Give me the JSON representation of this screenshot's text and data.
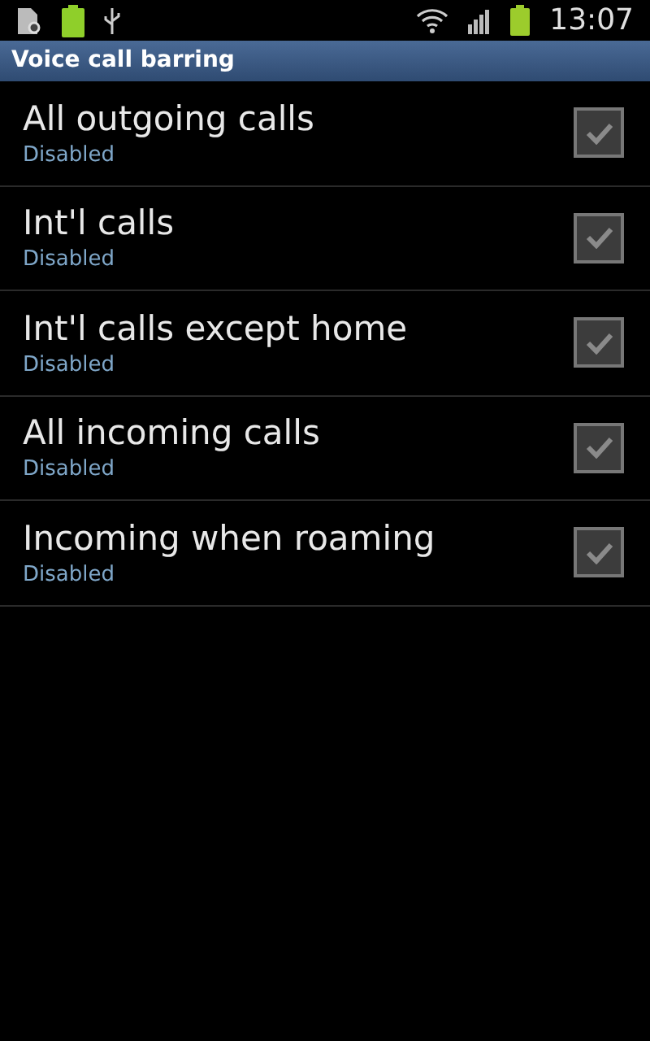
{
  "status_bar": {
    "time": "13:07"
  },
  "title": "Voice call barring",
  "items": [
    {
      "label": "All outgoing calls",
      "summary": "Disabled",
      "checked": true,
      "disabled": true
    },
    {
      "label": "Int'l calls",
      "summary": "Disabled",
      "checked": true,
      "disabled": true
    },
    {
      "label": "Int'l calls except home",
      "summary": "Disabled",
      "checked": true,
      "disabled": true
    },
    {
      "label": "All incoming calls",
      "summary": "Disabled",
      "checked": true,
      "disabled": true
    },
    {
      "label": "Incoming when roaming",
      "summary": "Disabled",
      "checked": true,
      "disabled": true
    }
  ]
}
